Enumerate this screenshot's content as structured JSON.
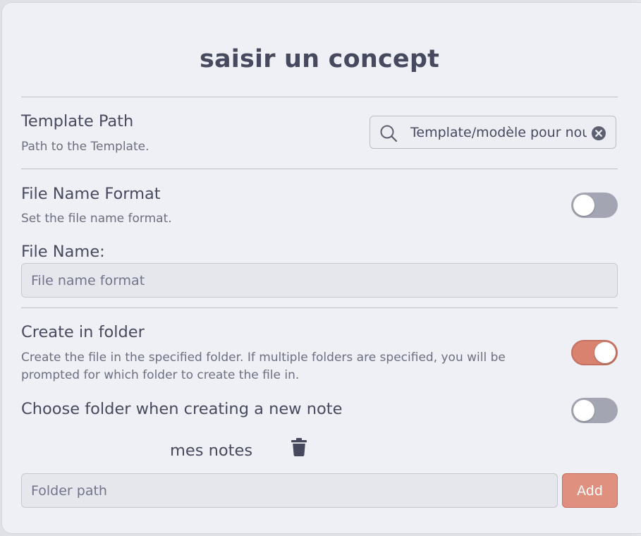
{
  "modal": {
    "title": "saisir un concept"
  },
  "template_path": {
    "label": "Template Path",
    "description": "Path to the Template.",
    "value": "Template/modèle pour nouveau concept"
  },
  "file_name_format": {
    "label": "File Name Format",
    "description": "Set the file name format.",
    "toggle_on": false,
    "field_label": "File Name:",
    "placeholder": "File name format"
  },
  "create_in_folder": {
    "label": "Create in folder",
    "description_line1": "Create the file in the specified folder. If multiple folders are specified, you will be",
    "description_line2": "prompted for which folder to create the file in.",
    "toggle_on": true
  },
  "choose_folder": {
    "label": "Choose folder when creating a new note",
    "toggle_on": false
  },
  "folders": [
    {
      "name": "mes notes"
    }
  ],
  "folder_input": {
    "placeholder": "Folder path",
    "add_label": "Add"
  },
  "colors": {
    "accent": "#e0907f",
    "toggle_off": "#a3a6b2",
    "text": "#474a5e",
    "muted": "#6c6f80",
    "background": "#eff0f5"
  },
  "icons": {
    "search": "search-icon",
    "clear": "clear-circle-icon",
    "delete": "trash-icon"
  }
}
